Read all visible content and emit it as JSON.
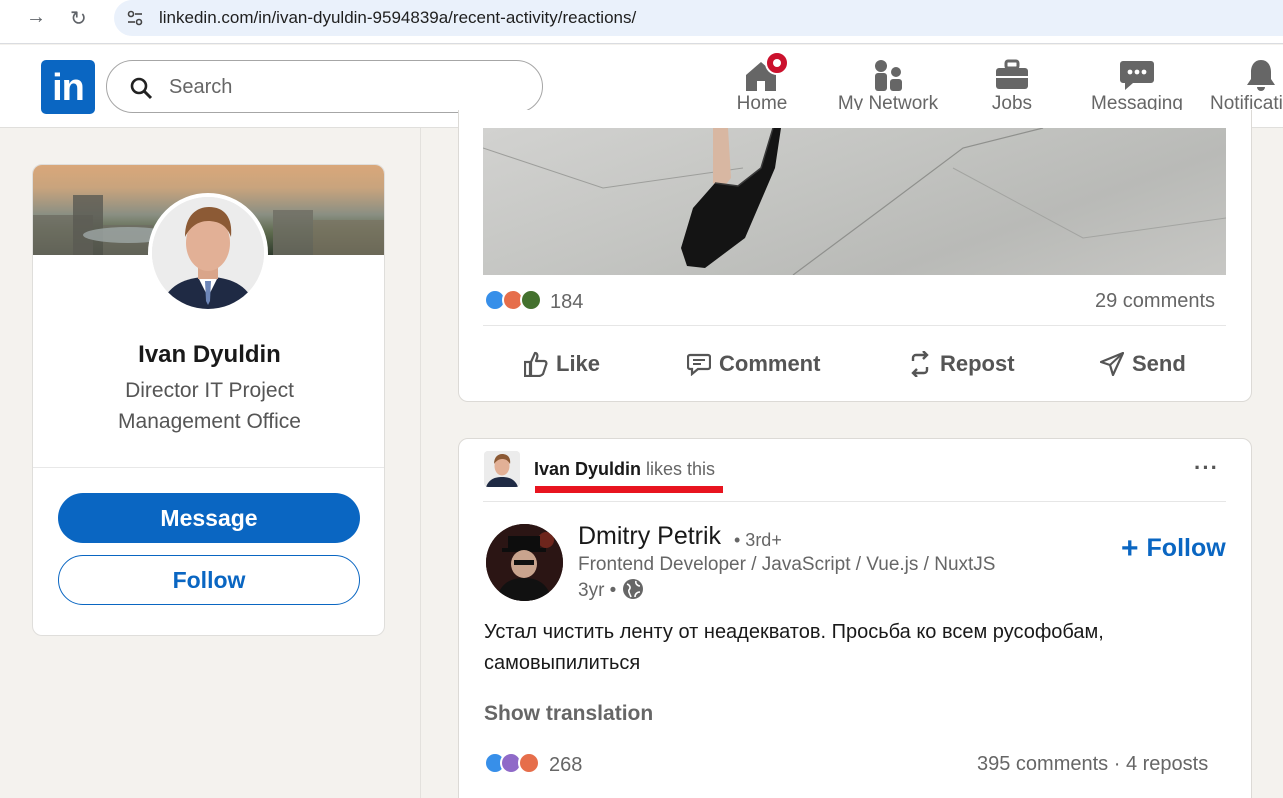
{
  "browser": {
    "url": "linkedin.com/in/ivan-dyuldin-9594839a/recent-activity/reactions/"
  },
  "header": {
    "logo": "in",
    "search_placeholder": "Search",
    "nav": [
      {
        "label": "Home",
        "icon": "home-icon"
      },
      {
        "label": "My Network",
        "icon": "network-icon"
      },
      {
        "label": "Jobs",
        "icon": "briefcase-icon"
      },
      {
        "label": "Messaging",
        "icon": "messaging-icon"
      },
      {
        "label": "Notificati",
        "icon": "bell-icon"
      }
    ]
  },
  "profile": {
    "name": "Ivan Dyuldin",
    "title": "Director IT Project Management Office",
    "message_label": "Message",
    "follow_label": "Follow"
  },
  "post1": {
    "reaction_count": "184",
    "comments": "29 comments",
    "actions": [
      "Like",
      "Comment",
      "Repost",
      "Send"
    ]
  },
  "post2": {
    "header_name": "Ivan Dyuldin",
    "header_suffix": "likes this",
    "more": "···",
    "author": {
      "name": "Dmitry Petrik",
      "degree": "• 3rd+",
      "headline": "Frontend Developer / JavaScript / Vue.js / NuxtJS",
      "time": "3yr •"
    },
    "follow_label": "Follow",
    "text": "Устал чистить ленту от неадекватов. Просьба ко всем русофобам, самовыпилиться",
    "show_translation": "Show translation",
    "reaction_count": "268",
    "comments_reposts": "395 comments · 4 reposts"
  },
  "colors": {
    "brand": "#0a66c2",
    "highlight_underline": "#e8141f",
    "notification_badge": "#cb112d"
  }
}
